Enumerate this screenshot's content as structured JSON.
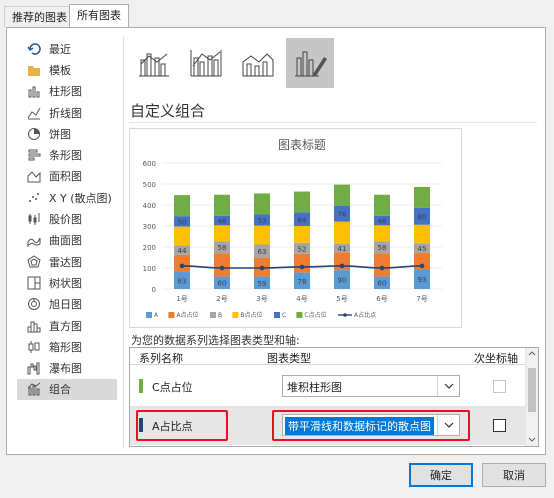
{
  "tabs": [
    "推荐的图表",
    "所有图表"
  ],
  "sidebar": [
    {
      "label": "最近",
      "icon": "recent-icon"
    },
    {
      "label": "模板",
      "icon": "folder-icon"
    },
    {
      "label": "柱形图",
      "icon": "column-chart-icon"
    },
    {
      "label": "折线图",
      "icon": "line-chart-icon"
    },
    {
      "label": "饼图",
      "icon": "pie-chart-icon"
    },
    {
      "label": "条形图",
      "icon": "bar-chart-icon"
    },
    {
      "label": "面积图",
      "icon": "area-chart-icon"
    },
    {
      "label": "X Y (散点图)",
      "icon": "scatter-chart-icon"
    },
    {
      "label": "股价图",
      "icon": "stock-chart-icon"
    },
    {
      "label": "曲面图",
      "icon": "surface-chart-icon"
    },
    {
      "label": "雷达图",
      "icon": "radar-chart-icon"
    },
    {
      "label": "树状图",
      "icon": "treemap-chart-icon"
    },
    {
      "label": "旭日图",
      "icon": "sunburst-chart-icon"
    },
    {
      "label": "直方图",
      "icon": "histogram-chart-icon"
    },
    {
      "label": "箱形图",
      "icon": "boxwhisker-chart-icon"
    },
    {
      "label": "瀑布图",
      "icon": "waterfall-chart-icon"
    },
    {
      "label": "组合",
      "icon": "combo-chart-icon"
    }
  ],
  "section_title": "自定义组合",
  "grid_label": "为您的数据系列选择图表类型和轴:",
  "grid_headers": {
    "name": "系列名称",
    "type": "图表类型",
    "axis": "次坐标轴"
  },
  "series_rows": [
    {
      "name": "C点占位",
      "type": "堆积柱形图",
      "color": "#70ad47",
      "secondary": false
    },
    {
      "name": "A占比点",
      "type": "带平滑线和数据标记的散点图",
      "color": "#264478",
      "secondary": false
    }
  ],
  "buttons": {
    "ok": "确定",
    "cancel": "取消"
  },
  "colors": {
    "A": "#5b9bd5",
    "A_pos": "#ed7d31",
    "B": "#a5a5a5",
    "B_pos": "#ffc000",
    "C": "#4472c4",
    "C_pos": "#70ad47",
    "A_ratio": "#264478",
    "highlight": "#e81123",
    "selection": "#0078d7"
  },
  "chart_data": {
    "type": "bar",
    "title": "图表标题",
    "categories": [
      "1号",
      "2号",
      "3号",
      "4号",
      "5号",
      "6号",
      "7号"
    ],
    "ylim": [
      0,
      600
    ],
    "yticks": [
      0,
      100,
      200,
      300,
      400,
      500,
      600
    ],
    "grid": true,
    "legend_position": "bottom",
    "series": [
      {
        "name": "A",
        "kind": "stacked-bar",
        "values": [
          83,
          60,
          59,
          78,
          90,
          60,
          93
        ],
        "labels": [
          "83",
          "60",
          "59",
          "78",
          "90",
          "60",
          "93"
        ]
      },
      {
        "name": "A点占位",
        "kind": "stacked-bar",
        "values": [
          80,
          110,
          90,
          90,
          85,
          110,
          80
        ],
        "labels": [
          "",
          "",
          "",
          "",
          "",
          "",
          ""
        ]
      },
      {
        "name": "B",
        "kind": "stacked-bar",
        "values": [
          44,
          58,
          63,
          52,
          41,
          58,
          45
        ],
        "labels": [
          "44",
          "58",
          "63",
          "52",
          "41",
          "58",
          "45"
        ]
      },
      {
        "name": "B点占位",
        "kind": "stacked-bar",
        "values": [
          90,
          75,
          90,
          80,
          105,
          75,
          88
        ],
        "labels": [
          "",
          "",
          "",
          "",
          "",
          "",
          ""
        ]
      },
      {
        "name": "C",
        "kind": "stacked-bar",
        "values": [
          50,
          46,
          53,
          64,
          76,
          46,
          80
        ],
        "labels": [
          "50",
          "46",
          "53",
          "64",
          "76",
          "46",
          "80"
        ]
      },
      {
        "name": "C点占位",
        "kind": "stacked-bar",
        "values": [
          100,
          100,
          100,
          100,
          100,
          100,
          100
        ],
        "labels": [
          "",
          "",
          "",
          "",
          "",
          "",
          ""
        ]
      },
      {
        "name": "A占比点",
        "kind": "line",
        "values": [
          110,
          100,
          100,
          105,
          110,
          100,
          110
        ]
      }
    ]
  }
}
